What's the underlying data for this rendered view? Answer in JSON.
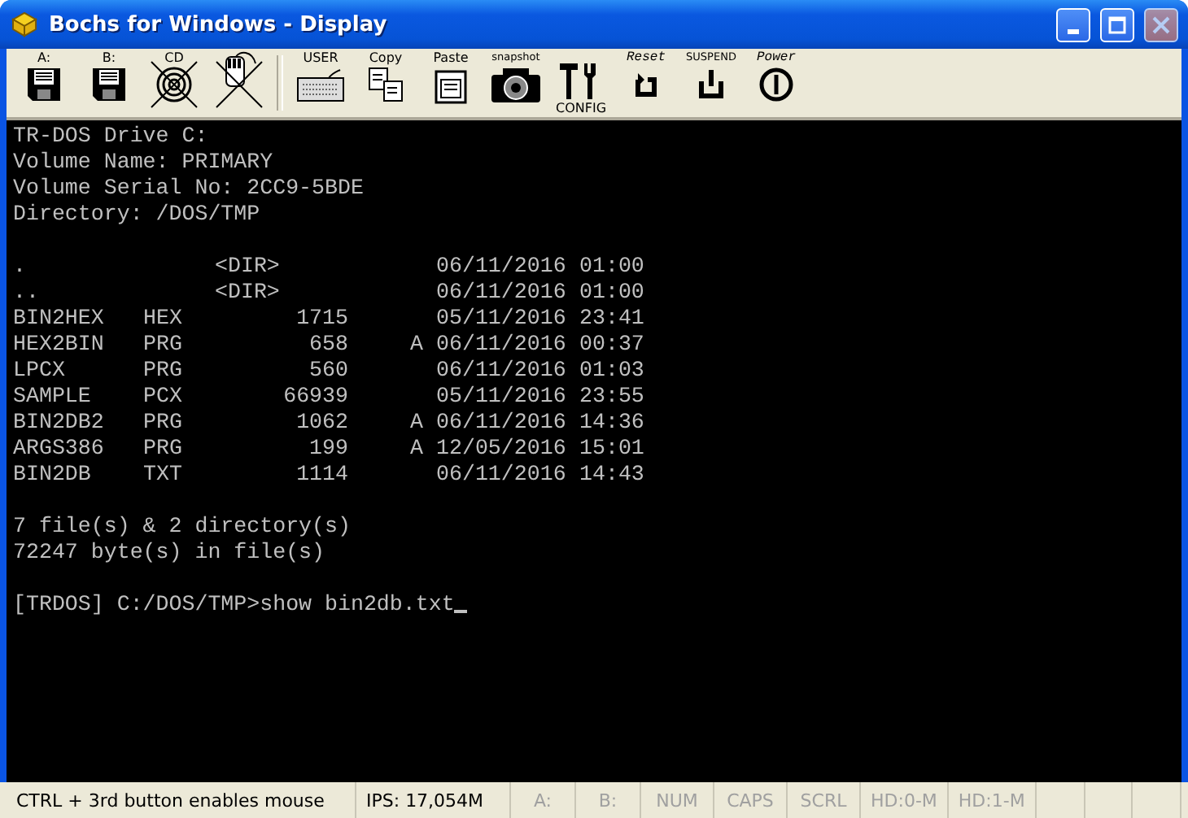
{
  "window": {
    "title": "Bochs for Windows - Display"
  },
  "toolbar": [
    {
      "kind": "floppy",
      "label": "A:",
      "crossed": false
    },
    {
      "kind": "floppy",
      "label": "B:",
      "crossed": false
    },
    {
      "kind": "cdrom",
      "label": "CD",
      "crossed": true
    },
    {
      "kind": "mouse",
      "crossed": true
    },
    {
      "kind": "separator"
    },
    {
      "kind": "keyboard",
      "label": "USER",
      "crossed": false
    },
    {
      "kind": "copy",
      "label": "Copy",
      "crossed": false
    },
    {
      "kind": "paste",
      "label": "Paste",
      "crossed": false
    },
    {
      "kind": "camera",
      "label": "snapshot",
      "crossed": false
    },
    {
      "kind": "config",
      "label": "CONFIG",
      "crossed": false
    },
    {
      "kind": "reset",
      "label": "Reset",
      "crossed": false
    },
    {
      "kind": "suspend",
      "label": "SUSPEND",
      "crossed": false
    },
    {
      "kind": "power",
      "label": "Power",
      "crossed": false
    }
  ],
  "terminal": {
    "header": [
      "TR-DOS Drive C:",
      "Volume Name: PRIMARY",
      "Volume Serial No: 2CC9-5BDE",
      "Directory: /DOS/TMP"
    ],
    "entries": [
      {
        "name": ".",
        "size": "<DIR>",
        "date": "06/11/2016",
        "time": "01:00"
      },
      {
        "name": "..",
        "size": "<DIR>",
        "date": "06/11/2016",
        "time": "01:00"
      },
      {
        "name": "BIN2HEX",
        "ext": "HEX",
        "size": "1715",
        "date": "05/11/2016",
        "time": "23:41"
      },
      {
        "name": "HEX2BIN",
        "ext": "PRG",
        "size": "658",
        "attr": "A",
        "date": "06/11/2016",
        "time": "00:37"
      },
      {
        "name": "LPCX",
        "ext": "PRG",
        "size": "560",
        "date": "06/11/2016",
        "time": "01:03"
      },
      {
        "name": "SAMPLE",
        "ext": "PCX",
        "size": "66939",
        "date": "05/11/2016",
        "time": "23:55"
      },
      {
        "name": "BIN2DB2",
        "ext": "PRG",
        "size": "1062",
        "attr": "A",
        "date": "06/11/2016",
        "time": "14:36"
      },
      {
        "name": "ARGS386",
        "ext": "PRG",
        "size": "199",
        "attr": "A",
        "date": "12/05/2016",
        "time": "15:01"
      },
      {
        "name": "BIN2DB",
        "ext": "TXT",
        "size": "1114",
        "date": "06/11/2016",
        "time": "14:43"
      }
    ],
    "summary": [
      "7 file(s) & 2 directory(s)",
      "72247 byte(s) in file(s)"
    ],
    "prompt": "[TRDOS] C:/DOS/TMP>",
    "command": "show bin2db.txt"
  },
  "status_bar": [
    {
      "text": "CTRL + 3rd button enables mouse",
      "active": true
    },
    {
      "text": "IPS: 17,054M",
      "active": true
    },
    {
      "text": "A:",
      "active": false
    },
    {
      "text": "B:",
      "active": false
    },
    {
      "text": "NUM",
      "active": false
    },
    {
      "text": "CAPS",
      "active": false
    },
    {
      "text": "SCRL",
      "active": false
    },
    {
      "text": "HD:0-M",
      "active": false
    },
    {
      "text": "HD:1-M",
      "active": false
    }
  ]
}
